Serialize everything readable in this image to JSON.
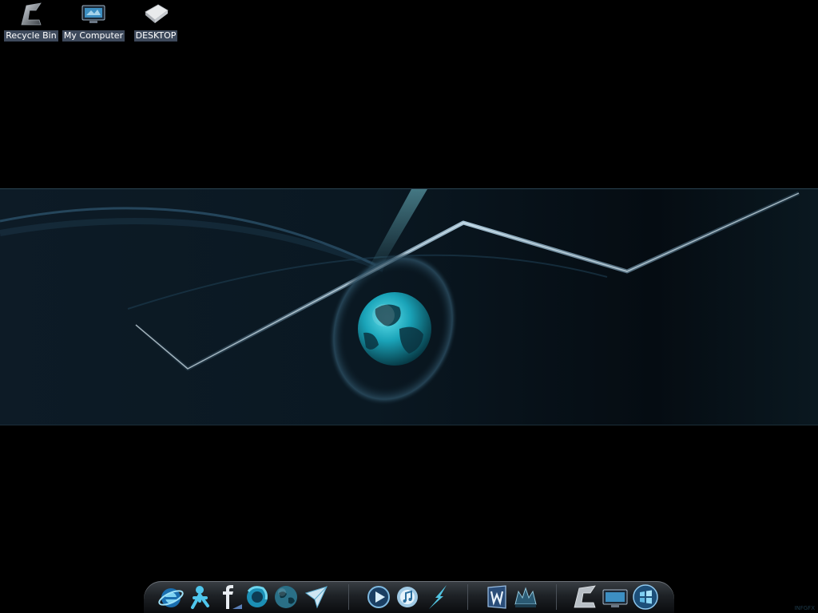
{
  "desktop": {
    "icons": [
      {
        "label": "Recycle Bin",
        "icon": "recycle-bin-icon"
      },
      {
        "label": "My Computer",
        "icon": "my-computer-icon"
      },
      {
        "label": "DESKTOP",
        "icon": "folder-icon"
      }
    ],
    "watermark": "INFGFX"
  },
  "dock": {
    "items": [
      {
        "icon": "internet-explorer-icon"
      },
      {
        "icon": "aim-messenger-icon"
      },
      {
        "icon": "facebook-icon"
      },
      {
        "icon": "firefox-icon"
      },
      {
        "icon": "messenger-globe-icon"
      },
      {
        "icon": "paper-plane-mail-icon"
      },
      {
        "icon": "media-player-icon"
      },
      {
        "icon": "itunes-icon"
      },
      {
        "icon": "lightning-app-icon"
      },
      {
        "icon": "word-icon"
      },
      {
        "icon": "game-crest-icon"
      },
      {
        "icon": "recycle-bin-icon"
      },
      {
        "icon": "my-computer-icon"
      },
      {
        "icon": "windows-start-icon"
      }
    ]
  },
  "colors": {
    "accent": "#2fb8d0",
    "label_bg": "#3e4a5c",
    "background": "#000000"
  }
}
